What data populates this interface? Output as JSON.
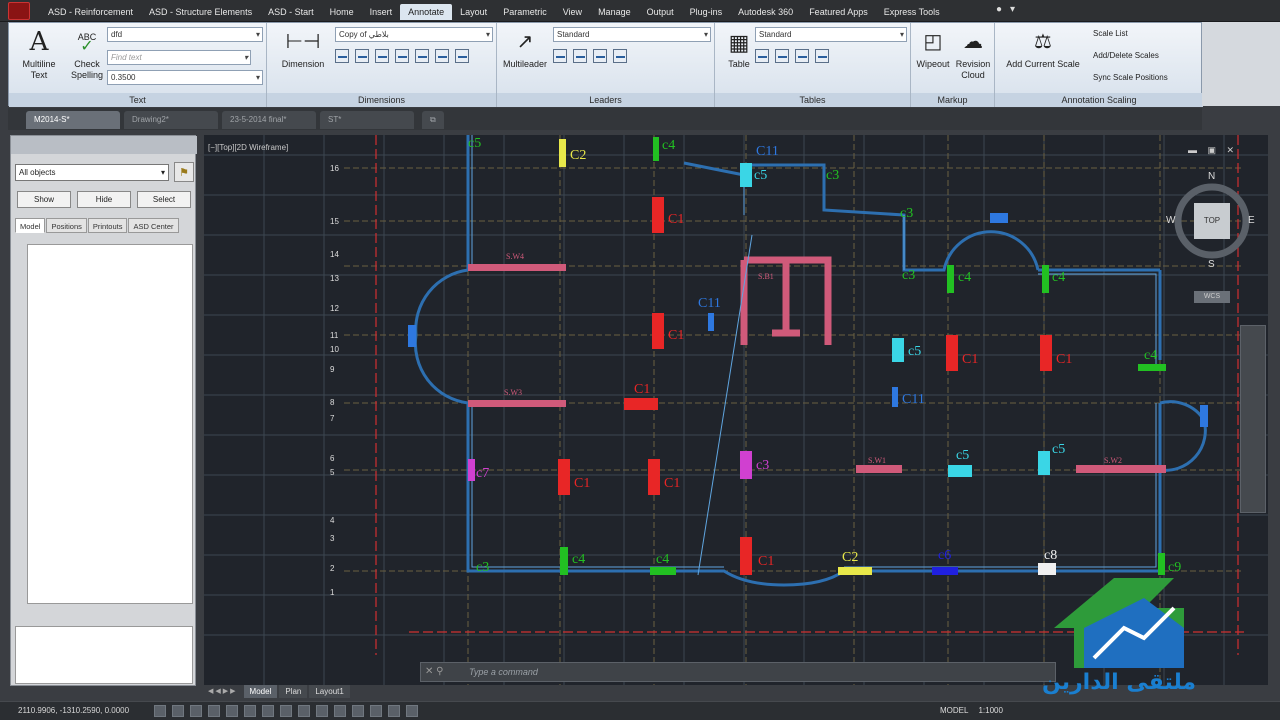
{
  "window": {
    "ribbon_tabs": [
      "ASD - Reinforcement",
      "ASD - Structure Elements",
      "ASD - Start",
      "Home",
      "Insert",
      "Annotate",
      "Layout",
      "Parametric",
      "View",
      "Manage",
      "Output",
      "Plug-ins",
      "Autodesk 360",
      "Featured Apps",
      "Express Tools"
    ],
    "active_tab": "Annotate"
  },
  "ribbon": {
    "text": {
      "label": "Text",
      "multiline": "Multiline Text",
      "check": "Check Spelling",
      "style": "dfd",
      "find": "Find text",
      "height": "0.3500",
      "abc": "ABC"
    },
    "dimensions": {
      "label": "Dimensions",
      "dimension": "Dimension",
      "style": "Copy of بلاطي"
    },
    "leaders": {
      "label": "Leaders",
      "multileader": "Multileader",
      "style": "Standard"
    },
    "tables": {
      "label": "Tables",
      "table": "Table",
      "style": "Standard"
    },
    "markup": {
      "label": "Markup",
      "wipeout": "Wipeout",
      "revision": "Revision Cloud"
    },
    "scaling": {
      "label": "Annotation Scaling",
      "add_current": "Add Current Scale",
      "scale_list": "Scale List",
      "add_delete": "Add/Delete Scales",
      "sync": "Sync Scale Positions"
    }
  },
  "doc_tabs": [
    "M2014-S*",
    "Drawing2*",
    "23-5-2014 final*",
    "ST*"
  ],
  "left_panel": {
    "filter": "All objects",
    "buttons": [
      "Show",
      "Hide",
      "Select"
    ],
    "tabs": [
      "Model",
      "Positions",
      "Printouts",
      "ASD Center"
    ]
  },
  "viewport": {
    "label": "[−][Top][2D Wireframe]",
    "compass": {
      "n": "N",
      "s": "S",
      "e": "E",
      "w": "W",
      "top": "TOP",
      "wcs": "WCS"
    },
    "rows": [
      "16",
      "15",
      "14",
      "13",
      "12",
      "11",
      "10",
      "9",
      "8",
      "7",
      "6",
      "5",
      "4",
      "3",
      "2",
      "1"
    ],
    "labels": {
      "c2_top": "C2",
      "c4_top": "c4",
      "c11_top": "C11",
      "c5_top": "c5",
      "c3_top": "c3",
      "c1_a": "C1",
      "c1_b": "C1",
      "c11_mid": "C11",
      "w4": "S.W4",
      "b1": "S.B1",
      "c3_r": "c3",
      "c4_r1": "c4",
      "c4_r2": "c4",
      "c3_r2": "c3",
      "c5_mid": "c5",
      "c1_r1": "C1",
      "c1_r2": "C1",
      "c4_r3": "c4",
      "c11_r": "C11",
      "w3": "S.W3",
      "c1_c": "C1",
      "c7": "c7",
      "c1_d": "C1",
      "c1_e": "C1",
      "c3_mid": "c3",
      "w1": "S.W1",
      "c5_b1": "c5",
      "c5_b2": "c5",
      "w2": "S.W2",
      "c4_b1": "c4",
      "c4_b2": "c4",
      "c1_f": "C1",
      "c2_b": "C2",
      "c3_b": "c3",
      "c8": "c8",
      "c6": "c6",
      "c9": "c9",
      "c5_c": "c5"
    }
  },
  "command": {
    "placeholder": "Type a command"
  },
  "layout_tabs": [
    "Model",
    "Plan",
    "Layout1"
  ],
  "status": {
    "coords": "2110.9906, -1310.2590, 0.0000",
    "model": "MODEL",
    "scale": "1:1000"
  },
  "watermark": {
    "text": "ملتقى الدارين"
  }
}
